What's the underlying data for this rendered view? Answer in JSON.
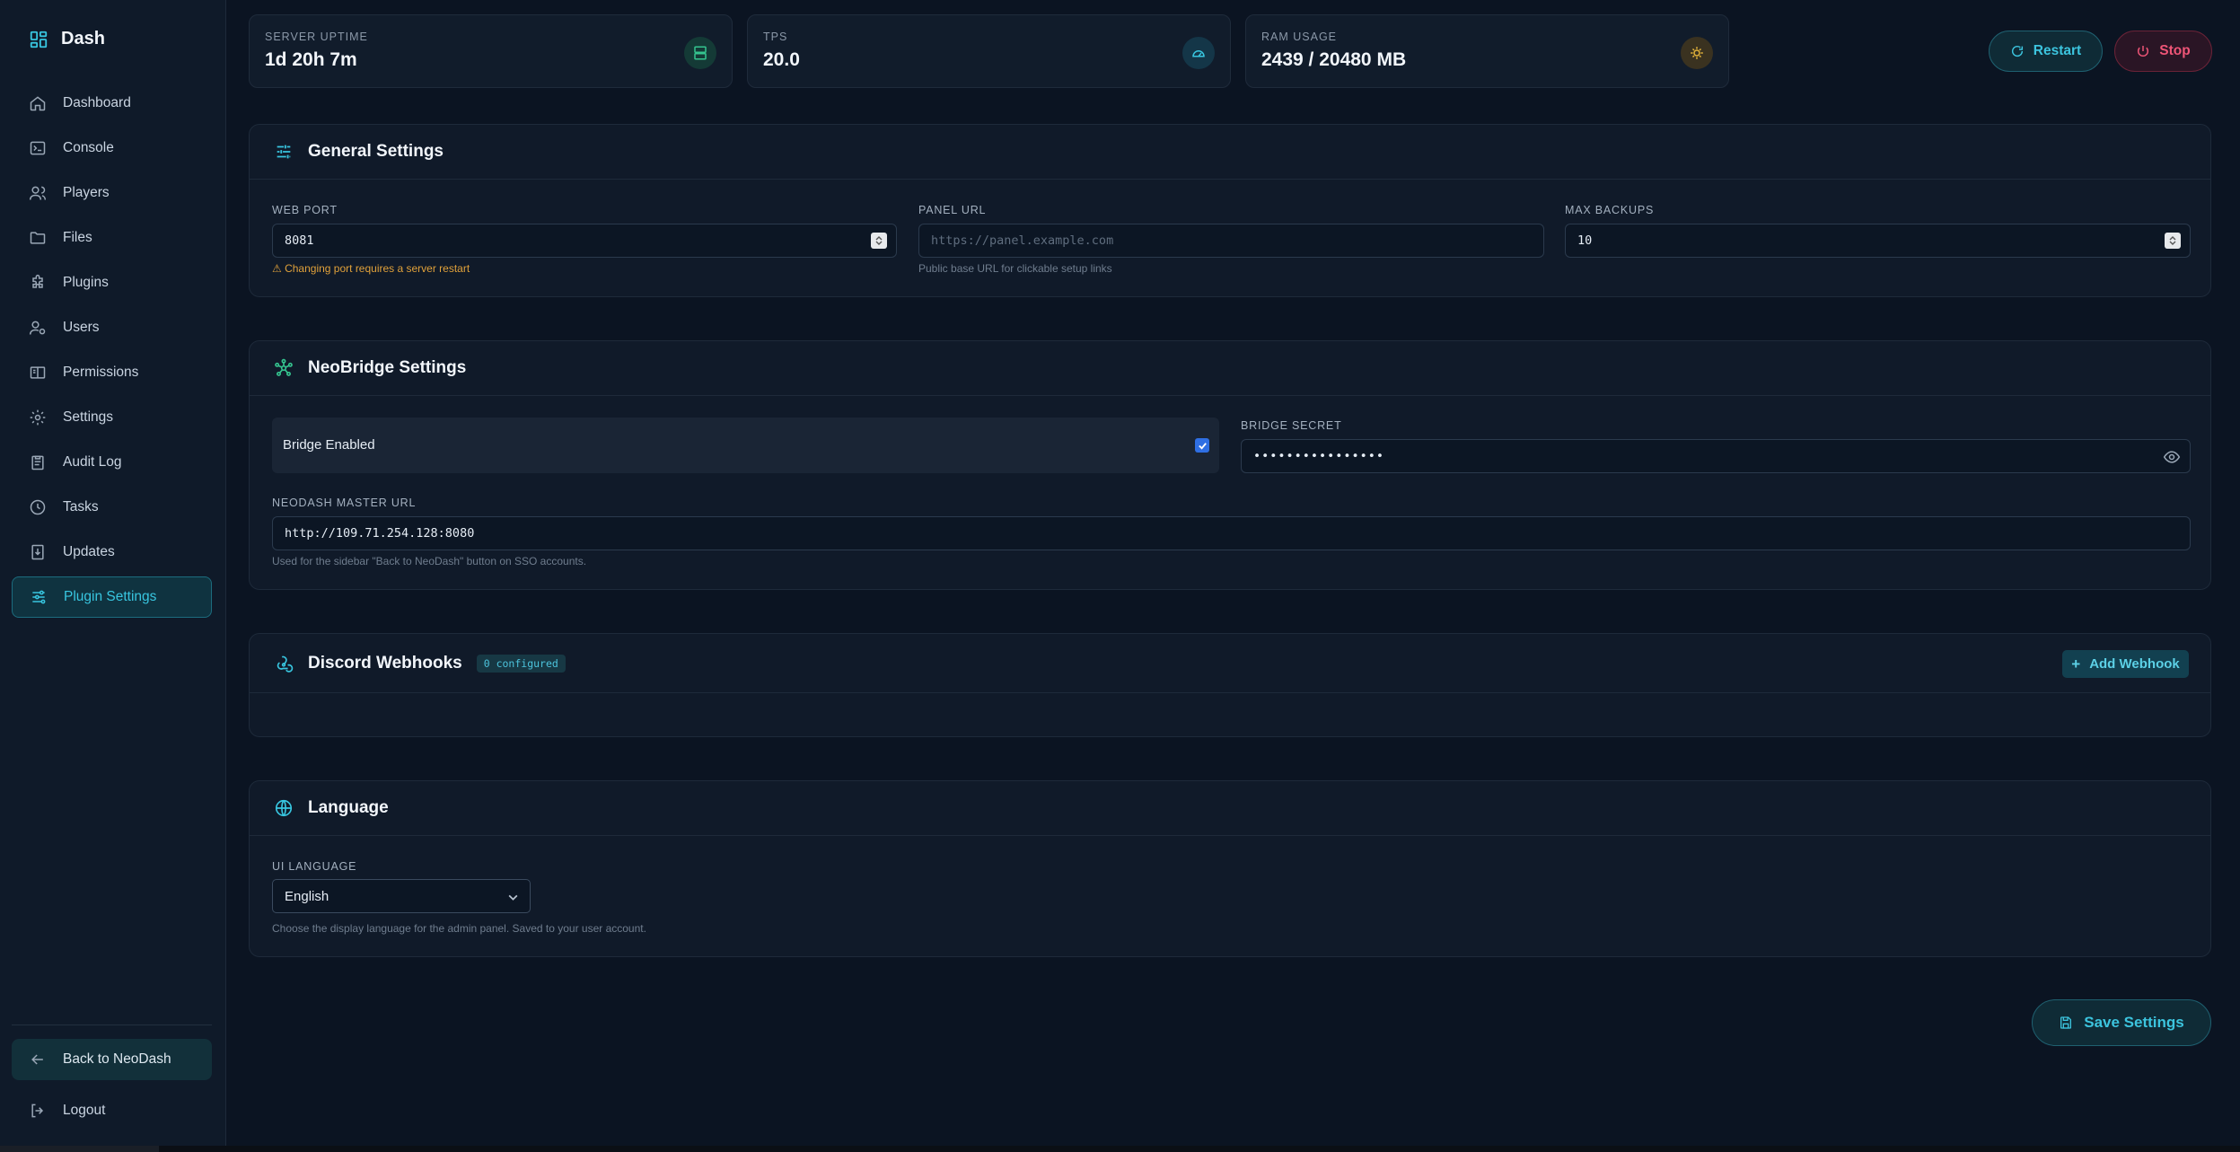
{
  "brand": {
    "name": "Dash",
    "icon": "dashboard-grid-icon"
  },
  "sidebar": {
    "items": [
      {
        "label": "Dashboard",
        "icon": "home-icon"
      },
      {
        "label": "Console",
        "icon": "terminal-icon"
      },
      {
        "label": "Players",
        "icon": "users-icon"
      },
      {
        "label": "Files",
        "icon": "folder-icon"
      },
      {
        "label": "Plugins",
        "icon": "puzzle-icon"
      },
      {
        "label": "Users",
        "icon": "user-cog-icon"
      },
      {
        "label": "Permissions",
        "icon": "book-icon"
      },
      {
        "label": "Settings",
        "icon": "gear-icon"
      },
      {
        "label": "Audit Log",
        "icon": "clipboard-icon"
      },
      {
        "label": "Tasks",
        "icon": "clock-icon"
      },
      {
        "label": "Updates",
        "icon": "download-icon"
      },
      {
        "label": "Plugin Settings",
        "icon": "sliders-icon",
        "active": true
      }
    ],
    "back_label": "Back to NeoDash",
    "logout_label": "Logout"
  },
  "stats": {
    "uptime": {
      "label": "SERVER UPTIME",
      "value": "1d 20h 7m"
    },
    "tps": {
      "label": "TPS",
      "value": "20.0"
    },
    "ram": {
      "label": "RAM USAGE",
      "value": "2439 / 20480 MB"
    }
  },
  "header": {
    "restart_label": "Restart",
    "stop_label": "Stop"
  },
  "general": {
    "title": "General Settings",
    "web_port": {
      "label": "WEB PORT",
      "value": "8081",
      "warning": "⚠ Changing port requires a server restart"
    },
    "panel_url": {
      "label": "PANEL URL",
      "placeholder": "https://panel.example.com",
      "hint": "Public base URL for clickable setup links"
    },
    "max_backups": {
      "label": "MAX BACKUPS",
      "value": "10"
    }
  },
  "neobridge": {
    "title": "NeoBridge Settings",
    "bridge_enabled_label": "Bridge Enabled",
    "bridge_enabled": true,
    "secret": {
      "label": "BRIDGE SECRET",
      "value": "••••••••••••••••"
    },
    "master_url": {
      "label": "NEODASH MASTER URL",
      "value": "http://109.71.254.128:8080",
      "hint": "Used for the sidebar \"Back to NeoDash\" button on SSO accounts."
    }
  },
  "webhooks": {
    "title": "Discord Webhooks",
    "badge": "0 configured",
    "add_label": "Add Webhook"
  },
  "language": {
    "title": "Language",
    "label": "UI LANGUAGE",
    "selected": "English",
    "hint": "Choose the display language for the admin panel. Saved to your user account."
  },
  "save_label": "Save Settings",
  "colors": {
    "accent": "#38c6e0",
    "danger": "#ef5577",
    "warning": "#e0a13a",
    "background": "#0b1422"
  }
}
